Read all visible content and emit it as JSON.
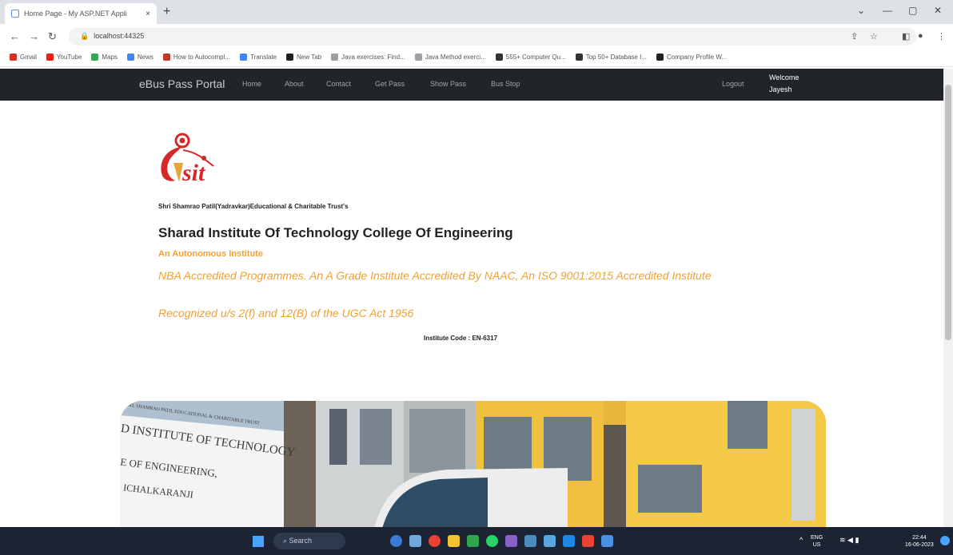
{
  "browser": {
    "tab_title": "Home Page - My ASP.NET Appli",
    "tab_close": "×",
    "new_tab": "+",
    "url": "localhost:44325",
    "bookmarks": [
      {
        "label": "Gmail",
        "color": "#d93025"
      },
      {
        "label": "YouTube",
        "color": "#e62117"
      },
      {
        "label": "Maps",
        "color": "#34a853"
      },
      {
        "label": "News",
        "color": "#4285f4"
      },
      {
        "label": "How to Autocompl...",
        "color": "#c0392b"
      },
      {
        "label": "Translate",
        "color": "#4285f4"
      },
      {
        "label": "New Tab",
        "color": "#202124"
      },
      {
        "label": "Java exercises: Find...",
        "color": "#9aa0a6"
      },
      {
        "label": "Java Method exerci...",
        "color": "#9aa0a6"
      },
      {
        "label": "555+ Computer Qu...",
        "color": "#333"
      },
      {
        "label": "Top 50+ Database I...",
        "color": "#333"
      },
      {
        "label": "Company Profile W...",
        "color": "#202124"
      }
    ]
  },
  "navbar": {
    "brand": "eBus Pass Portal",
    "links": [
      "Home",
      "About",
      "Contact",
      "Get Pass",
      "Show Pass",
      "Bus Stop"
    ],
    "logout": "Logout",
    "welcome": "Welcome",
    "user": "Jayesh"
  },
  "institute": {
    "trust": "Shri Shamrao Patil(Yadravkar)Educational & Charitable Trust's",
    "name": "Sharad Institute Of Technology College Of Engineering",
    "autonomous": "An Autonomous Institute",
    "accreditation": "NBA Accredited Programmes. An A Grade Institute Accredited By NAAC, An ISO 9001:2015 Accredited Institute",
    "recognition": "Recognized u/s 2(f) and 12(B) of the UGC Act 1956",
    "code": "Institute Code : EN-6317"
  },
  "banner": {
    "sign_lines": [
      "D INSTITUTE OF TECHNOLOGY",
      "E OF ENGINEERING,",
      "ICHALKARANJI"
    ]
  },
  "taskbar": {
    "search_label": "Search",
    "lang": "ENG",
    "region": "US",
    "time": "22:44",
    "date": "16-06-2023"
  }
}
